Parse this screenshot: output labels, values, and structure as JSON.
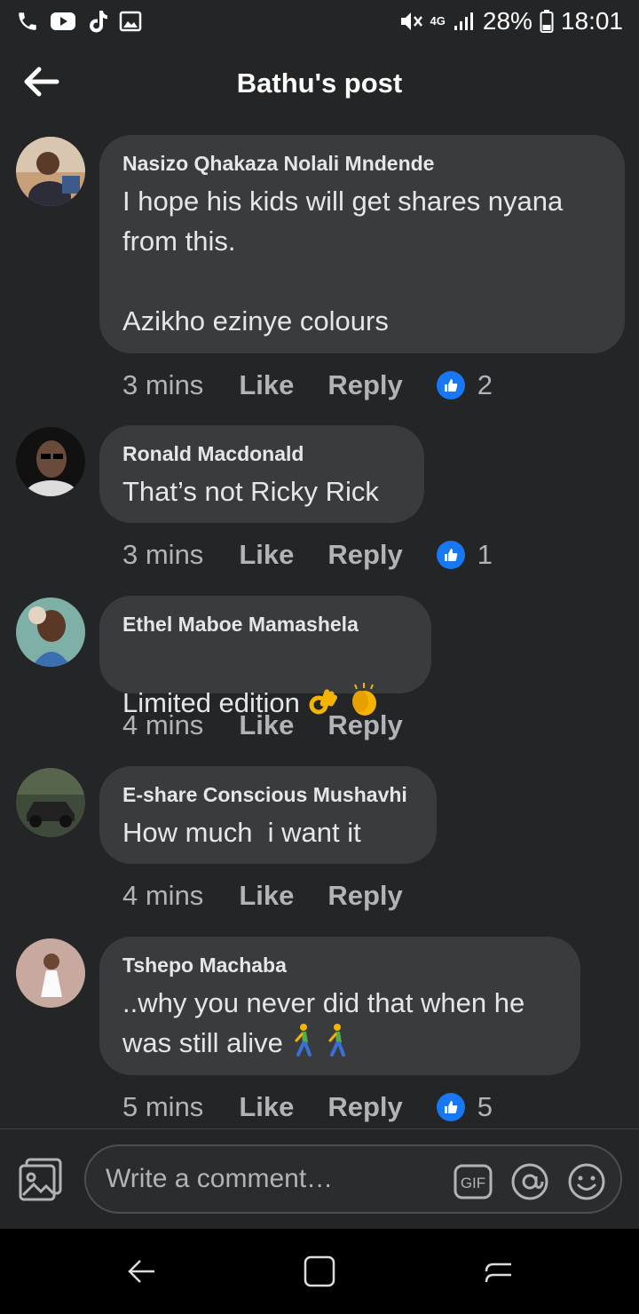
{
  "status_bar": {
    "left_icons": [
      "phone-icon",
      "youtube-icon",
      "tiktok-icon",
      "gallery-icon"
    ],
    "network": "4G",
    "battery": "28%",
    "time": "18:01"
  },
  "header": {
    "title": "Bathu's post"
  },
  "comments": [
    {
      "author": "Nasizo Qhakaza Nolali Mndende",
      "text": "I hope his kids will get shares nyana\nfrom this.\n\nAzikho ezinye colours",
      "time": "3 mins",
      "like": "Like",
      "reply": "Reply",
      "reactions": "2"
    },
    {
      "author": "Ronald Macdonald",
      "text": "That’s not Ricky Rick",
      "time": "3 mins",
      "like": "Like",
      "reply": "Reply",
      "reactions": "1"
    },
    {
      "author": "Ethel Maboe Mamashela",
      "text": "Limited edition",
      "time": "4 mins",
      "like": "Like",
      "reply": "Reply",
      "emoji": [
        "ok-hand-icon",
        "clapping-hands-icon"
      ]
    },
    {
      "author": "E-share Conscious Mushavhi",
      "text": "How much  i want it",
      "time": "4 mins",
      "like": "Like",
      "reply": "Reply"
    },
    {
      "author": "Tshepo Machaba",
      "text": "..why you never did that when he\nwas still alive",
      "time": "5 mins",
      "like": "Like",
      "reply": "Reply",
      "reactions": "5",
      "emoji": [
        "person-walking-icon",
        "person-walking-icon"
      ]
    }
  ],
  "composer": {
    "placeholder": "Write a comment…",
    "gif_label": "GIF"
  },
  "colors": {
    "background": "#242526",
    "bubble": "#3a3b3c",
    "like_blue": "#1877f2",
    "muted_text": "#b0b3b8"
  }
}
